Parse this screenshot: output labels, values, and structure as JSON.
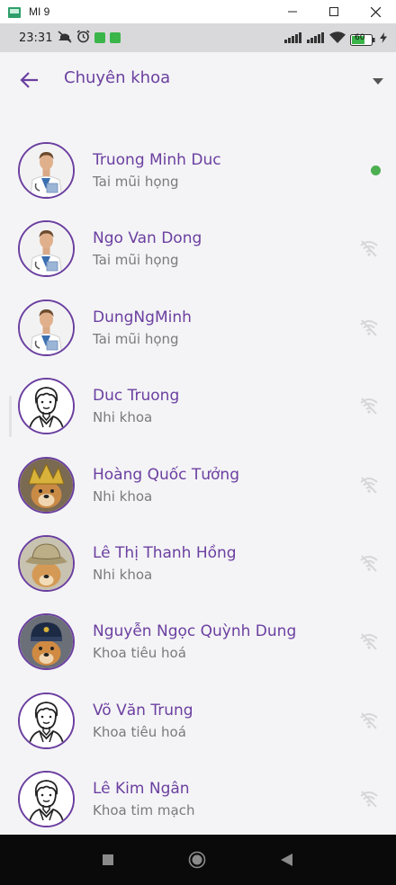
{
  "window": {
    "title": "MI 9"
  },
  "status_bar": {
    "time": "23:31",
    "battery": "60"
  },
  "app_bar": {
    "title": "Chuyên khoa"
  },
  "doctors": [
    {
      "name": "Truong Minh Duc",
      "specialty": "Tai mũi họng",
      "avatar": "doctor-photo",
      "status": "online"
    },
    {
      "name": "Ngo Van Dong",
      "specialty": "Tai mũi họng",
      "avatar": "doctor-photo",
      "status": "offline"
    },
    {
      "name": "DungNgMinh",
      "specialty": "Tai mũi họng",
      "avatar": "doctor-photo",
      "status": "offline"
    },
    {
      "name": "Duc Truong",
      "specialty": "Nhi khoa",
      "avatar": "doctor-sketch",
      "status": "offline"
    },
    {
      "name": "Hoàng Quốc Tưởng",
      "specialty": "Nhi khoa",
      "avatar": "dog-photo-gold",
      "status": "offline"
    },
    {
      "name": "Lê Thị Thanh Hồng",
      "specialty": "Nhi khoa",
      "avatar": "dog-photo-hat",
      "status": "offline"
    },
    {
      "name": "Nguyễn Ngọc Quỳnh Dung",
      "specialty": "Khoa tiêu hoá",
      "avatar": "dog-photo-cap",
      "status": "offline"
    },
    {
      "name": "Võ Văn Trung",
      "specialty": "Khoa tiêu hoá",
      "avatar": "doctor-sketch",
      "status": "offline"
    },
    {
      "name": "Lê Kim Ngân",
      "specialty": "Khoa tim mạch",
      "avatar": "doctor-sketch",
      "status": "offline"
    }
  ],
  "colors": {
    "accent": "#6b3fa0",
    "online": "#4caf50",
    "offline_icon": "#d6d6d9"
  }
}
